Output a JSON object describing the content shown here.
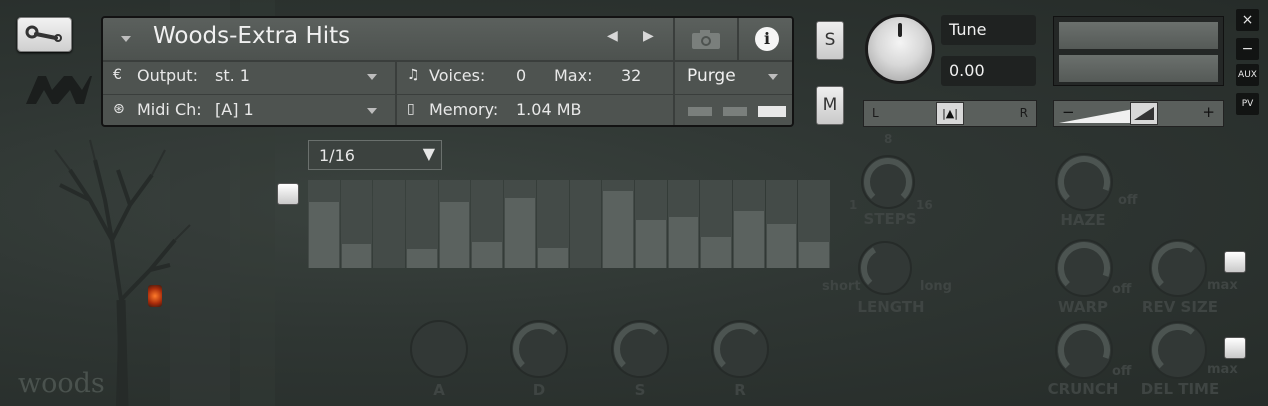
{
  "header": {
    "instrument_name": "Woods-Extra Hits",
    "output_label": "Output:",
    "output_value": "st. 1",
    "voices_label": "Voices:",
    "voices_value": "0",
    "max_label": "Max:",
    "max_value": "32",
    "purge_label": "Purge",
    "midi_label": "Midi Ch:",
    "midi_value": "[A] 1",
    "memory_label": "Memory:",
    "memory_value": "1.04 MB"
  },
  "channel": {
    "solo_label": "S",
    "mute_label": "M",
    "tune_label": "Tune",
    "tune_value": "0.00",
    "pan_left": "L",
    "pan_right": "R",
    "vol_minus": "−",
    "vol_plus": "+",
    "pan_position": 0.5,
    "volume_level": 0.5
  },
  "side_buttons": {
    "close": "×",
    "minimize": "−",
    "aux": "AUX",
    "pv": "PV"
  },
  "sequencer": {
    "rate_value": "1/16",
    "steps": [
      0.75,
      0.27,
      0.0,
      0.22,
      0.75,
      0.3,
      0.8,
      0.23,
      0.0,
      0.87,
      0.55,
      0.58,
      0.35,
      0.65,
      0.5,
      0.3
    ]
  },
  "controls": {
    "steps_label": "STEPS",
    "steps_min": "1",
    "steps_max": "16",
    "steps_mid": "8",
    "length_label": "LENGTH",
    "length_min": "short",
    "length_max": "long",
    "haze_label": "HAZE",
    "haze_off": "off",
    "warp_label": "WARP",
    "warp_off": "off",
    "rev_size_label": "REV SIZE",
    "rev_size_max": "max",
    "crunch_label": "CRUNCH",
    "crunch_off": "off",
    "del_time_label": "DEL TIME",
    "del_time_max": "max"
  },
  "adsr": {
    "a": "A",
    "d": "D",
    "s": "S",
    "r": "R"
  },
  "brand": {
    "logo_text": "woods"
  }
}
